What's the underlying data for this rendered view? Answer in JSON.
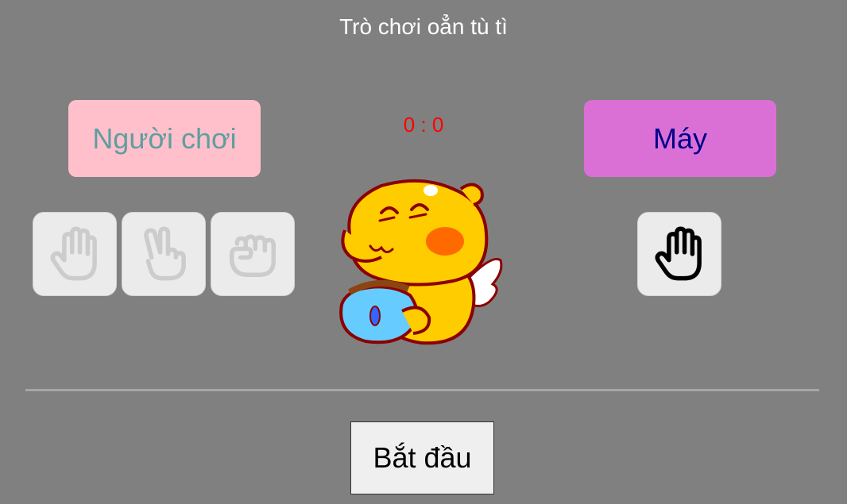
{
  "title": "Trò chơi oẳn tù tì",
  "player": {
    "label": "Người chơi",
    "choices": [
      {
        "icon": "hand-paper-icon",
        "name": "paper"
      },
      {
        "icon": "hand-scissors-icon",
        "name": "scissors"
      },
      {
        "icon": "hand-rock-icon",
        "name": "rock"
      }
    ],
    "enabled": false
  },
  "machine": {
    "label": "Máy",
    "choice_icon": "hand-paper-icon"
  },
  "score": "0 : 0",
  "start_button": "Bắt đầu",
  "colors": {
    "background": "#808080",
    "player_label_bg": "#ffc0cb",
    "player_label_text": "#5f9ea0",
    "machine_label_bg": "#da70d6",
    "machine_label_text": "#00008b",
    "score_text": "#ff0000"
  }
}
